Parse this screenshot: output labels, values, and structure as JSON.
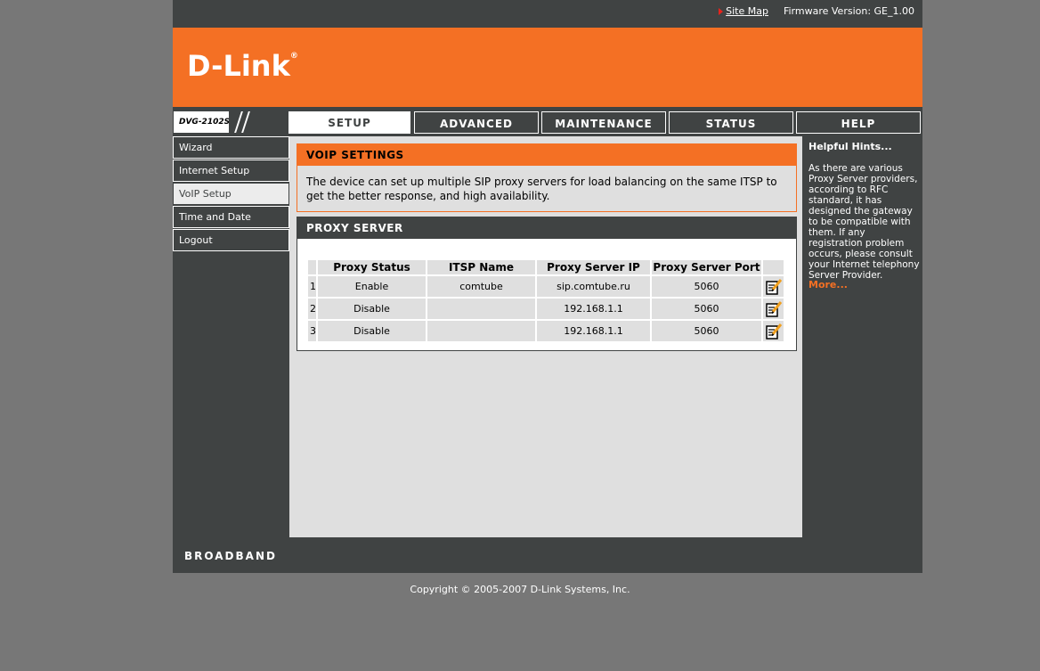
{
  "topbar": {
    "site_map": "Site Map",
    "firmware": "Firmware Version: GE_1.00"
  },
  "brand": {
    "logo": "D-Link",
    "trademark": "®",
    "model": "DVG-2102S",
    "footer": "BROADBAND"
  },
  "tabs": [
    {
      "label": "SETUP",
      "active": true
    },
    {
      "label": "ADVANCED",
      "active": false
    },
    {
      "label": "MAINTENANCE",
      "active": false
    },
    {
      "label": "STATUS",
      "active": false
    },
    {
      "label": "HELP",
      "active": false
    }
  ],
  "sidebar": {
    "items": [
      {
        "label": "Wizard"
      },
      {
        "label": "Internet Setup"
      },
      {
        "label": "VoIP Setup"
      },
      {
        "label": "Time and Date"
      },
      {
        "label": "Logout"
      }
    ],
    "active_index": 2
  },
  "voip": {
    "title": "VOIP SETTINGS",
    "description": "The device can set up multiple SIP proxy servers for load balancing on the same ITSP to get the better response, and high availability."
  },
  "proxy": {
    "title": "PROXY SERVER",
    "columns": [
      "Proxy Status",
      "ITSP Name",
      "Proxy Server IP",
      "Proxy Server Port"
    ],
    "rows": [
      {
        "index": "1",
        "status": "Enable",
        "itsp": "comtube",
        "ip": "sip.comtube.ru",
        "port": "5060"
      },
      {
        "index": "2",
        "status": "Disable",
        "itsp": "",
        "ip": "192.168.1.1",
        "port": "5060"
      },
      {
        "index": "3",
        "status": "Disable",
        "itsp": "",
        "ip": "192.168.1.1",
        "port": "5060"
      }
    ]
  },
  "hints": {
    "title": "Helpful Hints...",
    "body": "As there are various Proxy Server providers, according to RFC standard, it has designed the gateway to be compatible with them. If any registration problem occurs, please consult your Internet telephony Server Provider.",
    "more": "More..."
  },
  "copyright": "Copyright © 2005-2007 D-Link Systems, Inc.",
  "colors": {
    "orange": "#f47024",
    "dark": "#404343",
    "panel": "#dfdfdf",
    "background": "#777777"
  }
}
